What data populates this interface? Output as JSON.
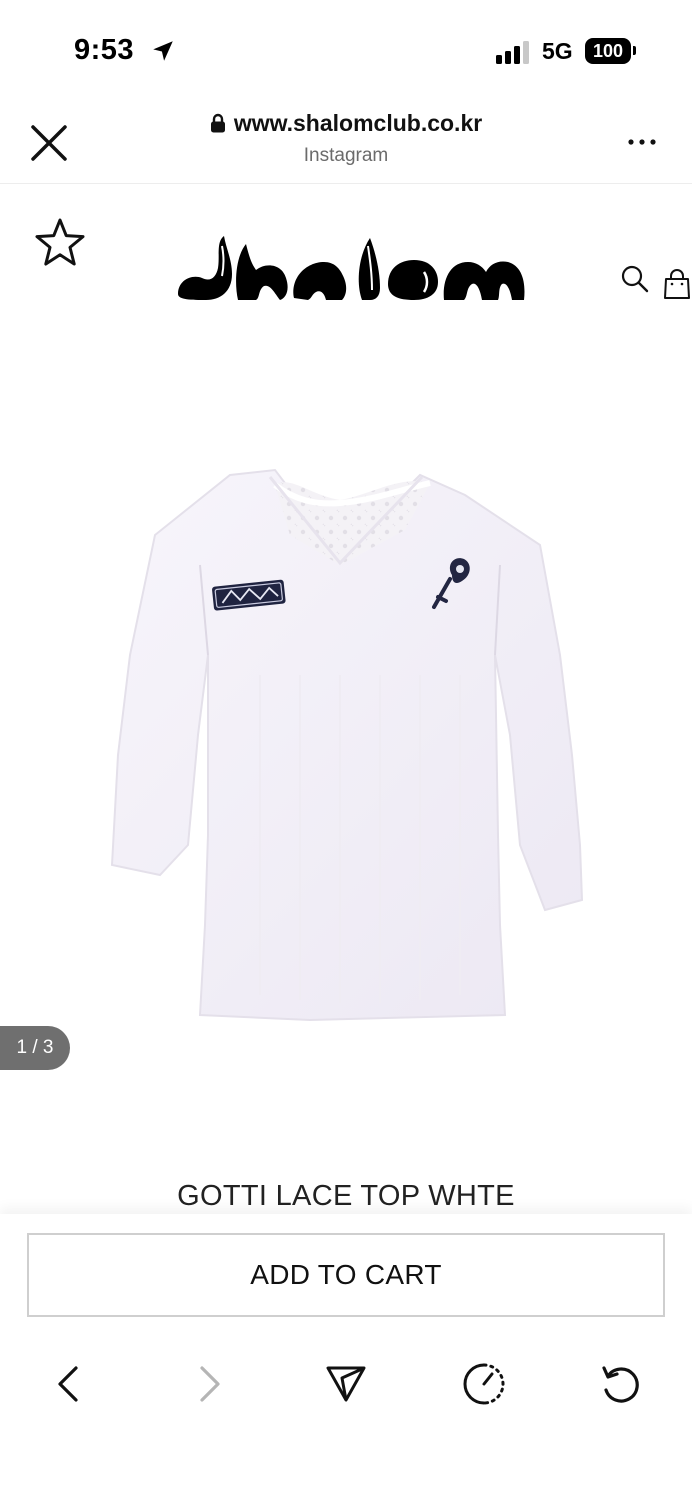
{
  "status_bar": {
    "time": "9:53",
    "network": "5G",
    "battery": "100"
  },
  "browser": {
    "url": "www.shalomclub.co.kr",
    "source": "Instagram"
  },
  "site": {
    "logo_text": "shalom"
  },
  "product": {
    "image_counter": "1 / 3",
    "name": "GOTTI LACE TOP WHTE",
    "add_to_cart_label": "ADD TO CART"
  },
  "colors": {
    "text": "#111111",
    "muted": "#6b6b6b",
    "counter_bg": "#6f6f6f",
    "border": "#cfcfcf"
  },
  "icons": [
    "close-icon",
    "lock-icon",
    "more-icon",
    "star-icon",
    "search-icon",
    "bag-icon",
    "back-icon",
    "forward-icon",
    "share-icon",
    "history-icon",
    "reload-icon"
  ]
}
